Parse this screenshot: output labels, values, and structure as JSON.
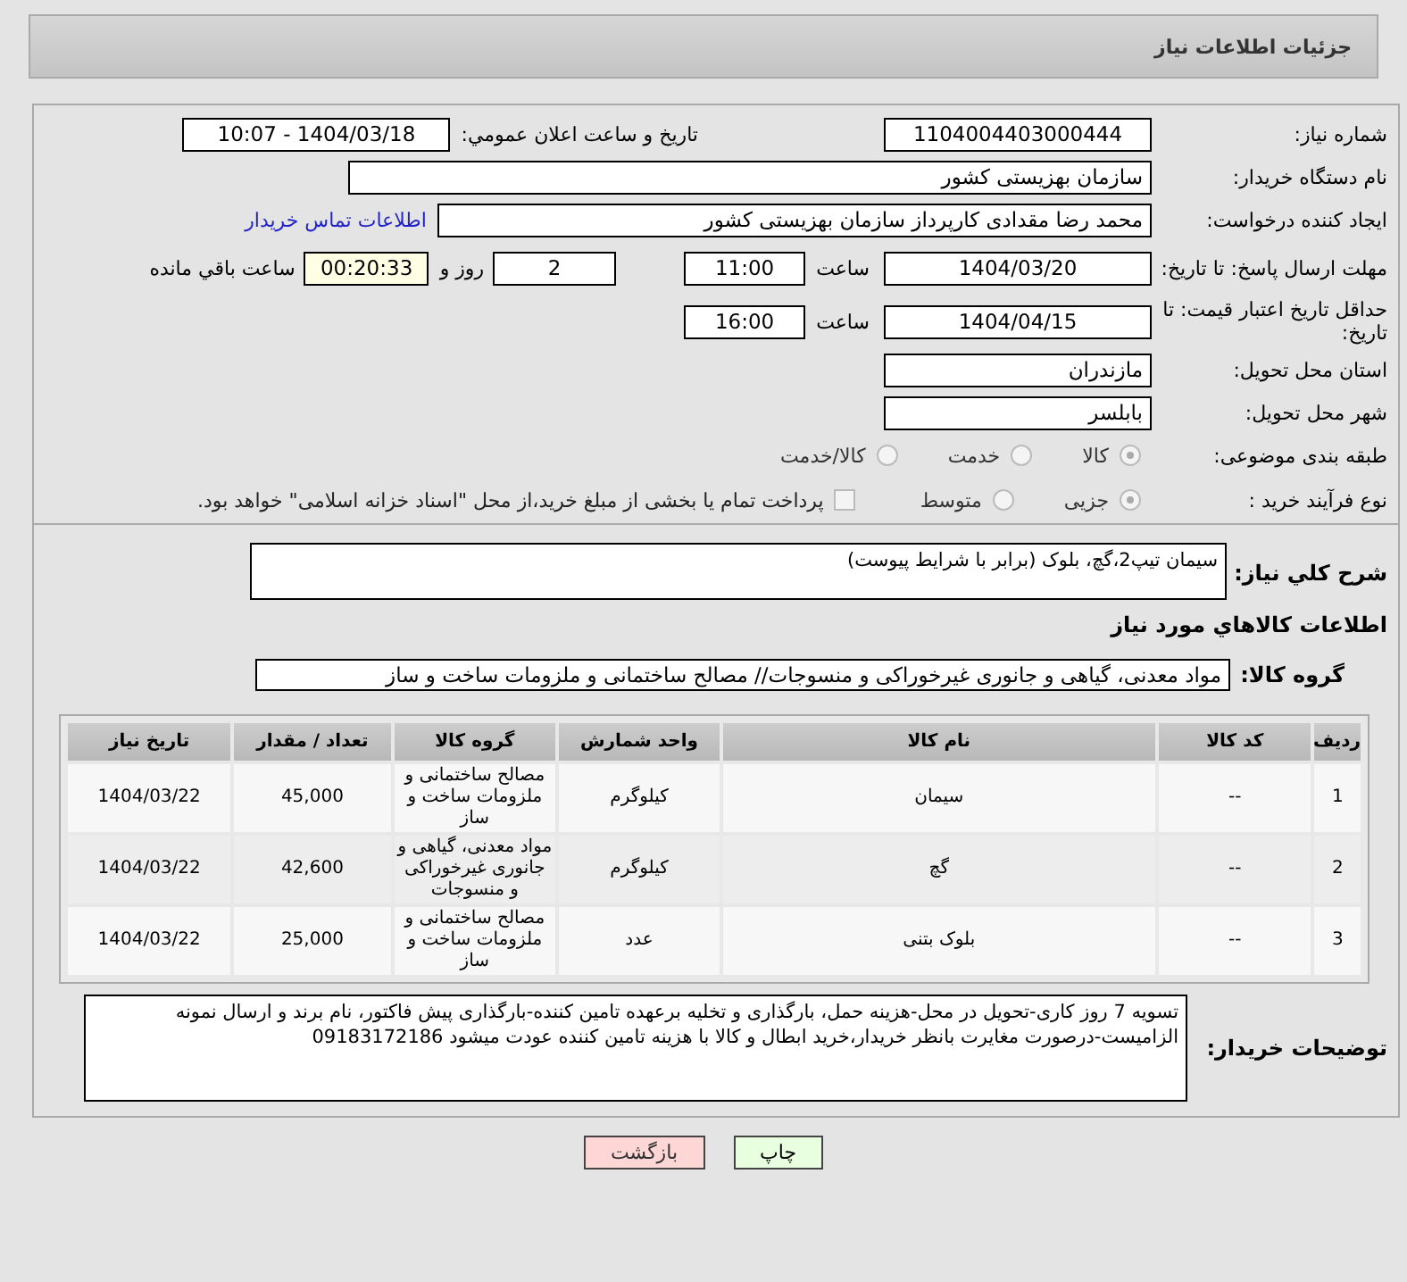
{
  "header": {
    "title": "جزئیات اطلاعات نیاز"
  },
  "need_number": {
    "label": "شماره نیاز:",
    "value": "1104004403000444"
  },
  "announce": {
    "label": "تاریخ و ساعت اعلان عمومي:",
    "value": "1404/03/18 - 10:07"
  },
  "buyer_org": {
    "label": "نام دستگاه خریدار:",
    "value": "سازمان بهزیستی کشور"
  },
  "requester": {
    "label": "ایجاد کننده درخواست:",
    "value": "محمد رضا  مقدادی کارپرداز سازمان بهزیستی کشور",
    "link": "اطلاعات تماس خریدار"
  },
  "reply_deadline": {
    "label": "مهلت ارسال پاسخ: تا تاریخ:",
    "date": "1404/03/20",
    "time_label": "ساعت",
    "time": "11:00",
    "days": "2",
    "days_label": "روز و",
    "remaining": "00:20:33",
    "remaining_label": "ساعت باقي مانده"
  },
  "price_validity": {
    "label": "حداقل تاریخ اعتبار قیمت: تا تاریخ:",
    "date": "1404/04/15",
    "time_label": "ساعت",
    "time": "16:00"
  },
  "province": {
    "label": "استان محل تحویل:",
    "value": "مازندران"
  },
  "city": {
    "label": "شهر محل تحویل:",
    "value": "بابلسر"
  },
  "subject_type": {
    "label": "طبقه بندی موضوعی:",
    "options": [
      {
        "label": "کالا",
        "selected": true
      },
      {
        "label": "خدمت",
        "selected": false
      },
      {
        "label": "کالا/خدمت",
        "selected": false
      }
    ]
  },
  "purchase_process": {
    "label": "نوع فرآیند خرید :",
    "options": [
      {
        "label": "جزیی",
        "selected": true
      },
      {
        "label": "متوسط",
        "selected": false
      }
    ],
    "treasury": {
      "label": "پرداخت تمام یا بخشی از مبلغ خرید،از محل \"اسناد خزانه اسلامی\" خواهد بود.",
      "checked": false
    }
  },
  "description": {
    "label": "شرح کلي نیاز:",
    "value": "سیمان تیپ2،گچ، بلوک (برابر با شرایط پیوست)"
  },
  "goods_heading": "اطلاعات کالاهاي مورد نیاز",
  "goods_group": {
    "label": "گروه کالا:",
    "value": "مواد معدنی، گیاهی و جانوری غیرخوراکی و منسوجات// مصالح ساختمانی و ملزومات ساخت و ساز"
  },
  "table": {
    "columns": [
      "ردیف",
      "کد کالا",
      "نام کالا",
      "واحد شمارش",
      "گروه کالا",
      "تعداد / مقدار",
      "تاریخ نیاز"
    ],
    "rows": [
      [
        "1",
        "--",
        "سیمان",
        "کیلوگرم",
        "مصالح ساختمانی و ملزومات ساخت و ساز",
        "45,000",
        "1404/03/22"
      ],
      [
        "2",
        "--",
        "گچ",
        "کیلوگرم",
        "مواد معدنی، گیاهی و جانوری غیرخوراکی و منسوجات",
        "42,600",
        "1404/03/22"
      ],
      [
        "3",
        "--",
        "بلوک بتنی",
        "عدد",
        "مصالح ساختمانی و ملزومات ساخت و ساز",
        "25,000",
        "1404/03/22"
      ]
    ]
  },
  "buyer_notes": {
    "label": "توضیحات خریدار:",
    "value": "تسویه 7 روز کاری-تحویل در محل-هزینه حمل، بارگذاری و تخلیه برعهده تامین کننده-بارگذاری پیش فاکتور، نام برند و ارسال نمونه الزامیست-درصورت مغایرت بانظر خریدار،خرید ابطال و کالا با هزینه  تامین کننده عودت میشود 09183172186"
  },
  "buttons": [
    {
      "label": "چاپ",
      "kind": "print"
    },
    {
      "label": "بازگشت",
      "kind": "back"
    }
  ]
}
